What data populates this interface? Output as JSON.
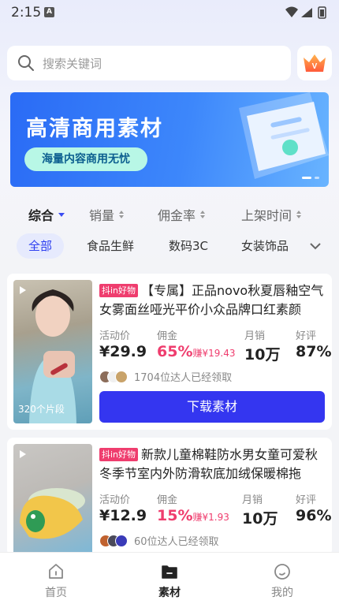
{
  "status_bar": {
    "time": "2:15",
    "notif": "A"
  },
  "search": {
    "placeholder": "搜索关键词"
  },
  "banner": {
    "title": "高清商用素材",
    "subtitle": "海量内容商用无忧"
  },
  "sort": [
    {
      "label": "综合",
      "active": true
    },
    {
      "label": "销量",
      "active": false
    },
    {
      "label": "佣金率",
      "active": false
    },
    {
      "label": "上架时间",
      "active": false
    }
  ],
  "categories": [
    {
      "label": "全部",
      "active": true
    },
    {
      "label": "食品生鲜",
      "active": false
    },
    {
      "label": "数码3C",
      "active": false
    },
    {
      "label": "女装饰品",
      "active": false
    }
  ],
  "stat_labels": {
    "price": "活动价",
    "commission": "佣金",
    "sales": "月销",
    "rating": "好评"
  },
  "earn_prefix": "赚",
  "download_label": "下载素材",
  "products": [
    {
      "tag": "抖in好物",
      "title": "【专属】正品novo秋夏唇釉空气女雾面丝哑光平价小众品牌口红素颜",
      "price": "¥29.9",
      "commission_rate": "65%",
      "commission_amount": "¥19.43",
      "sales": "10万",
      "rating": "87%",
      "claim_text": "1704位达人已经领取",
      "clips": "320个片段"
    },
    {
      "tag": "抖in好物",
      "title": "新款儿童棉鞋防水男女童可爱秋冬季节室内外防滑软底加绒保暖棉拖",
      "price": "¥12.9",
      "commission_rate": "15%",
      "commission_amount": "¥1.93",
      "sales": "10万",
      "rating": "96%",
      "claim_text": "60位达人已经领取"
    }
  ],
  "tabs": [
    {
      "label": "首页",
      "icon": "home-icon",
      "active": false
    },
    {
      "label": "素材",
      "icon": "material-icon",
      "active": true
    },
    {
      "label": "我的",
      "icon": "profile-icon",
      "active": false
    }
  ],
  "colors": {
    "accent": "#3436f0",
    "commission": "#ef3d6e",
    "banner": "#2a6bf5"
  }
}
